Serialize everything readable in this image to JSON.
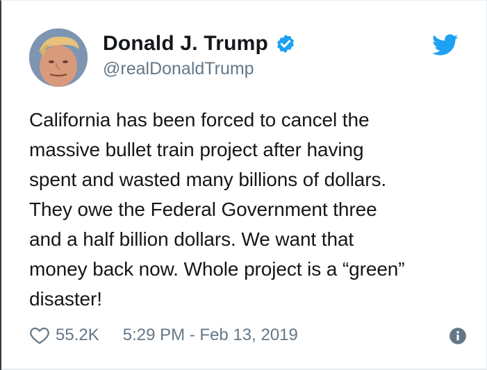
{
  "author": {
    "display_name": "Donald J. Trump",
    "handle": "@realDonaldTrump",
    "verified": true
  },
  "tweet": {
    "lines": [
      "California has been forced to cancel the",
      "massive bullet train project after having",
      "spent and wasted many billions of dollars.",
      "They owe the Federal Government three",
      "and a half billion dollars. We want that",
      "money back now. Whole project is a “green”",
      "disaster!"
    ]
  },
  "footer": {
    "like_count": "55.2K",
    "timestamp": "5:29 PM - Feb 13, 2019"
  },
  "icons": {
    "brand": "twitter-bird-icon",
    "verified": "verified-badge-icon",
    "like": "heart-icon",
    "info": "info-icon"
  },
  "colors": {
    "brand_blue": "#1da1f2",
    "text": "#14171a",
    "secondary": "#657786"
  }
}
